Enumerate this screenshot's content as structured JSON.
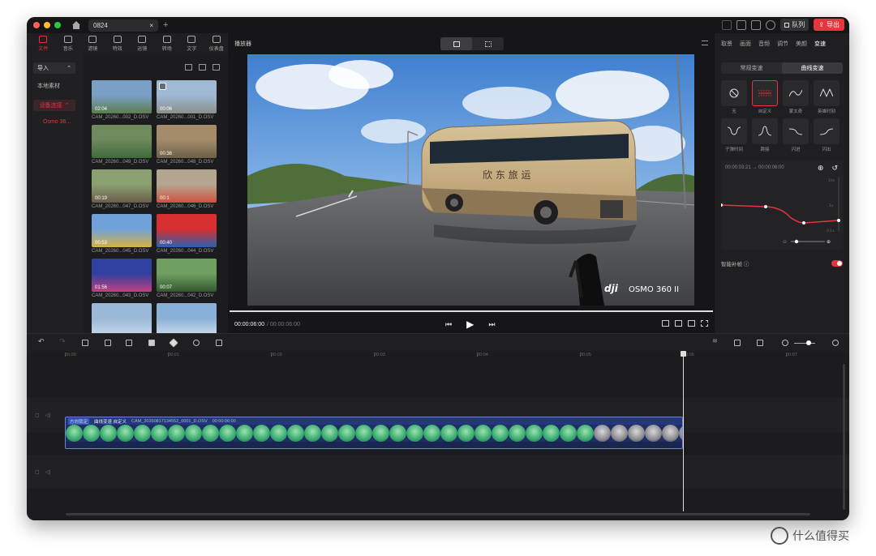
{
  "window": {
    "tab_title": "0824",
    "tab_close": "×",
    "tab_add": "+"
  },
  "titlebar": {
    "queue_label": "队列",
    "export_label": "导出"
  },
  "media_toolbar": [
    {
      "label": "文件",
      "icon": "folder-icon",
      "active": true
    },
    {
      "label": "音乐",
      "icon": "music-icon"
    },
    {
      "label": "滤镜",
      "icon": "filter-icon"
    },
    {
      "label": "特效",
      "icon": "sparkle-icon"
    },
    {
      "label": "运镜",
      "icon": "camera-move-icon"
    },
    {
      "label": "转场",
      "icon": "transition-icon"
    },
    {
      "label": "文字",
      "icon": "text-icon"
    },
    {
      "label": "仪表盘",
      "icon": "gauge-icon"
    }
  ],
  "left_nav": {
    "import": "导入",
    "local_material": "本地素材",
    "device": "设备连接",
    "device_sub": "Osmo 36..."
  },
  "media": [
    {
      "label": "CAM_20260...002_D.OSV",
      "duration": "02:04",
      "colors": [
        "#7aa0c8",
        "#5b7d4b"
      ]
    },
    {
      "label": "CAM_20260...001_D.OSV",
      "duration": "00:06",
      "colors": [
        "#9fb8d4",
        "#8a8f8a"
      ],
      "checked": true
    },
    {
      "label": "CAM_20260...049_D.OSV",
      "duration": "",
      "colors": [
        "#6f8a5c",
        "#3f6a3a"
      ]
    },
    {
      "label": "CAM_20260...048_D.OSV",
      "duration": "00:36",
      "colors": [
        "#a48b6a",
        "#6d6048"
      ]
    },
    {
      "label": "CAM_20260...047_D.OSV",
      "duration": "00:19",
      "colors": [
        "#8aa070",
        "#6b5c4c"
      ]
    },
    {
      "label": "CAM_20260...046_D.OSV",
      "duration": "00:1",
      "colors": [
        "#b4a58e",
        "#d05040"
      ]
    },
    {
      "label": "CAM_20260...045_D.OSV",
      "duration": "00:53",
      "colors": [
        "#6fa2d8",
        "#d8b040"
      ]
    },
    {
      "label": "CAM_20260...044_D.OSV",
      "duration": "00:40",
      "colors": [
        "#d83030",
        "#2a60b0"
      ]
    },
    {
      "label": "CAM_20260...043_D.OSV",
      "duration": "01:56",
      "colors": [
        "#3040a0",
        "#c04080"
      ]
    },
    {
      "label": "CAM_20260...042_D.OSV",
      "duration": "00:07",
      "colors": [
        "#70a060",
        "#305830"
      ]
    },
    {
      "label": "",
      "duration": "",
      "colors": [
        "#9ab8d8",
        "#c8d8e8"
      ]
    },
    {
      "label": "",
      "duration": "",
      "colors": [
        "#88b0d8",
        "#d0dcea"
      ]
    }
  ],
  "player": {
    "title": "播放器",
    "current_time": "00:00:06:00",
    "total_time": "/ 00:00:06:00",
    "progress": 1.0,
    "watermark_brand": "dji",
    "watermark_product": "OSMO 360 II",
    "bus_text": "欣 东 旅 运"
  },
  "right_panel": {
    "tabs": [
      "取景",
      "画面",
      "音频",
      "调节",
      "美颜",
      "变速"
    ],
    "active_tab": "变速",
    "speed_modes": [
      "常规变速",
      "曲线变速"
    ],
    "active_speed_mode": "曲线变速",
    "curves": [
      {
        "label": "无",
        "icon": "none-icon"
      },
      {
        "label": "自定义",
        "icon": "custom-curve-icon",
        "active": true
      },
      {
        "label": "蒙太奇",
        "icon": "montage-curve-icon"
      },
      {
        "label": "英雄时刻",
        "icon": "hero-curve-icon"
      },
      {
        "label": "子弹时间",
        "icon": "bullet-curve-icon"
      },
      {
        "label": "跳接",
        "icon": "jump-curve-icon"
      },
      {
        "label": "闪进",
        "icon": "flash-in-curve-icon"
      },
      {
        "label": "闪出",
        "icon": "flash-out-curve-icon"
      }
    ],
    "graph_time": "00:00:03:21 → 00:00:06:00",
    "graph_scale_top": "10x",
    "graph_scale_mid": "1x",
    "graph_scale_bot": "0.1x",
    "smart_frame": "智能补帧",
    "smart_frame_on": true
  },
  "timeline": {
    "ticks": [
      "00:00",
      "00:01",
      "00:02",
      "00:03",
      "00:04",
      "00:05",
      "00:06",
      "00:07"
    ],
    "clip": {
      "tag": "方向锁定",
      "effect": "曲线变速 自定义",
      "name": "CAM_20260817134552_0001_D.OSV",
      "duration": "00:00:06:00"
    }
  },
  "page_watermark": "什么值得买"
}
